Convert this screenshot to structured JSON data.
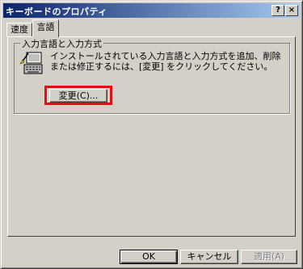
{
  "window": {
    "title": "キーボードのプロパティ",
    "help_label": "?",
    "close_label": "×"
  },
  "tabs": [
    {
      "label": "速度",
      "active": false
    },
    {
      "label": "言語",
      "active": true
    }
  ],
  "group": {
    "title": "入力言語と入力方式",
    "description": "インストールされている入力言語と入力方式を追加、削除または修正するには、[変更] をクリックしてください。",
    "icon": "keyboard-input-icon",
    "change_button": "変更(C)..."
  },
  "footer": {
    "ok": "OK",
    "cancel": "キャンセル",
    "apply": "適用(A)"
  },
  "colors": {
    "highlight": "#e01010",
    "title_start": "#0a246a",
    "title_end": "#a6caf0"
  }
}
